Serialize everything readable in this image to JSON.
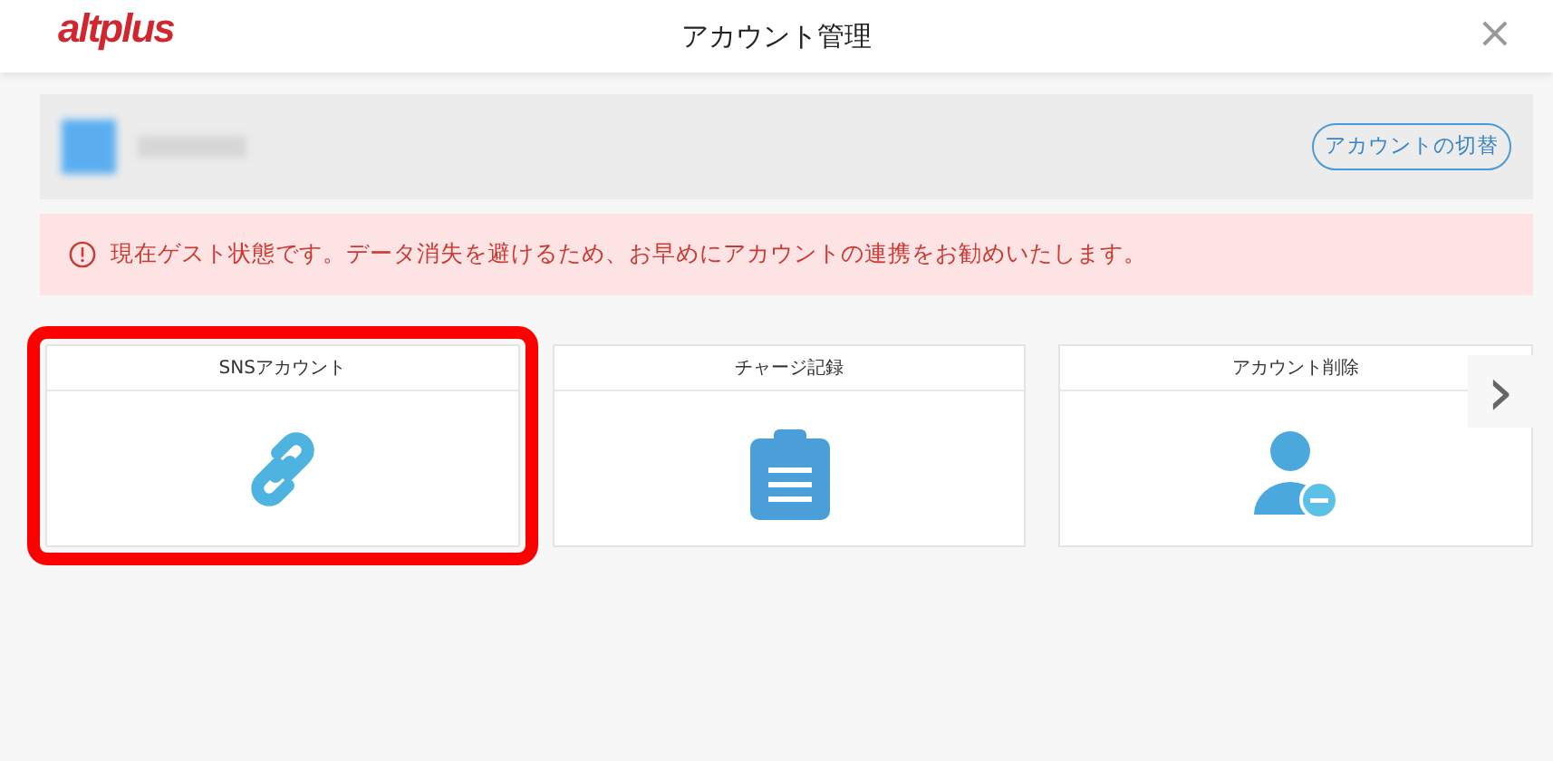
{
  "header": {
    "logo": "altplus",
    "title": "アカウント管理",
    "close": "×"
  },
  "account": {
    "switch_button": "アカウントの切替"
  },
  "alert": {
    "message": "現在ゲスト状態です。データ消失を避けるため、お早めにアカウントの連携をお勧めいたします。"
  },
  "menu_cards": [
    {
      "label": "SNSアカウント",
      "kind": "link",
      "highlighted": true
    },
    {
      "label": "チャージ記録",
      "kind": "clipboard",
      "highlighted": false
    },
    {
      "label": "アカウント削除",
      "kind": "user-remove",
      "highlighted": false
    }
  ],
  "next_arrow": "›"
}
